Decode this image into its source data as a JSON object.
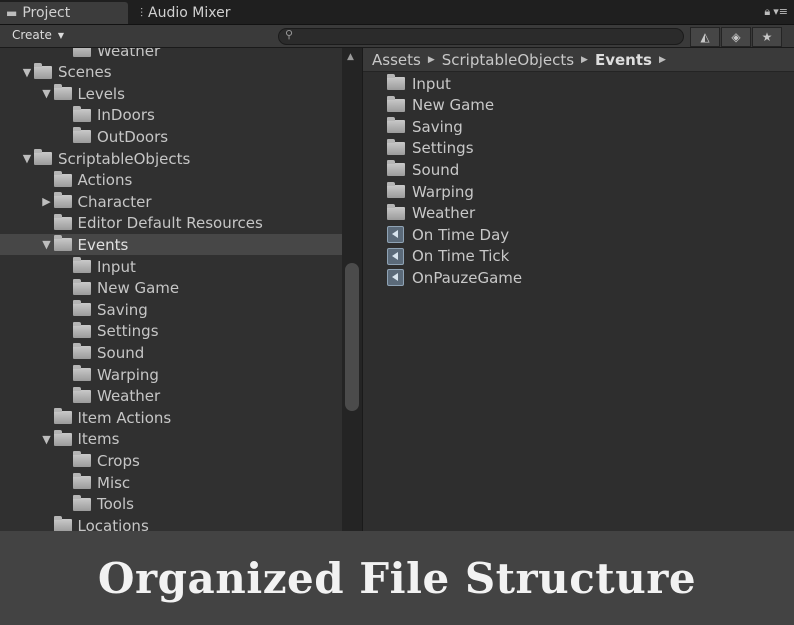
{
  "tabs": [
    {
      "label": "Project",
      "icon": "folder-icon"
    },
    {
      "label": "Audio Mixer",
      "icon": "mixer-icon"
    }
  ],
  "toolbar": {
    "create_label": "Create",
    "search_value": "",
    "search_placeholder": ""
  },
  "tree": [
    {
      "label": "Weather",
      "depth": 2,
      "expanded": null
    },
    {
      "label": "Scenes",
      "depth": 0,
      "expanded": true
    },
    {
      "label": "Levels",
      "depth": 1,
      "expanded": true
    },
    {
      "label": "InDoors",
      "depth": 2,
      "expanded": null
    },
    {
      "label": "OutDoors",
      "depth": 2,
      "expanded": null
    },
    {
      "label": "ScriptableObjects",
      "depth": 0,
      "expanded": true
    },
    {
      "label": "Actions",
      "depth": 1,
      "expanded": null
    },
    {
      "label": "Character",
      "depth": 1,
      "expanded": false
    },
    {
      "label": "Editor Default Resources",
      "depth": 1,
      "expanded": null
    },
    {
      "label": "Events",
      "depth": 1,
      "expanded": true,
      "selected": true
    },
    {
      "label": "Input",
      "depth": 2,
      "expanded": null
    },
    {
      "label": "New Game",
      "depth": 2,
      "expanded": null
    },
    {
      "label": "Saving",
      "depth": 2,
      "expanded": null
    },
    {
      "label": "Settings",
      "depth": 2,
      "expanded": null
    },
    {
      "label": "Sound",
      "depth": 2,
      "expanded": null
    },
    {
      "label": "Warping",
      "depth": 2,
      "expanded": null
    },
    {
      "label": "Weather",
      "depth": 2,
      "expanded": null
    },
    {
      "label": "Item Actions",
      "depth": 1,
      "expanded": null
    },
    {
      "label": "Items",
      "depth": 1,
      "expanded": true
    },
    {
      "label": "Crops",
      "depth": 2,
      "expanded": null
    },
    {
      "label": "Misc",
      "depth": 2,
      "expanded": null
    },
    {
      "label": "Tools",
      "depth": 2,
      "expanded": null
    },
    {
      "label": "Locations",
      "depth": 1,
      "expanded": null
    }
  ],
  "breadcrumb": [
    "Assets",
    "ScriptableObjects",
    "Events"
  ],
  "contents": [
    {
      "label": "Input",
      "type": "folder"
    },
    {
      "label": "New Game",
      "type": "folder"
    },
    {
      "label": "Saving",
      "type": "folder"
    },
    {
      "label": "Settings",
      "type": "folder"
    },
    {
      "label": "Sound",
      "type": "folder"
    },
    {
      "label": "Warping",
      "type": "folder"
    },
    {
      "label": "Weather",
      "type": "folder"
    },
    {
      "label": "On Time Day",
      "type": "asset"
    },
    {
      "label": "On Time Tick",
      "type": "asset"
    },
    {
      "label": "OnPauzeGame",
      "type": "asset"
    }
  ],
  "banner": {
    "text": "Organized File Structure"
  }
}
